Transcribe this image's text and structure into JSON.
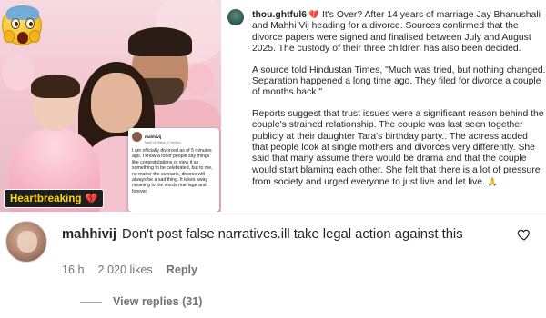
{
  "photo": {
    "tag_label": "Heartbreaking",
    "inset": {
      "username": "mahhivij",
      "subline": "Mahi Vij Mahhi Vj Verified",
      "text": "I am officially divorced as of 5 minutes ago. I know a lot of people say things like congratulations or view it as something to be celebrated, but to me, no matter the scenario, divorce will always be a sad thing. It takes away meaning to the words marriage and forever."
    }
  },
  "caption": {
    "username": "thou.ghtful6",
    "paragraphs": [
      "It's Over? After 14 years of marriage Jay Bhanushali and Mahhi Vij heading for a divorce. Sources confirmed that the divorce papers were signed and finalised between July and August 2025. The custody of their three children has also been decided.",
      "A source told Hindustan Times, \"Much was tried, but nothing changed. Separation happened a long time ago. They filed for divorce a couple of months back.\"",
      "Reports suggest that trust issues were a significant reason behind the couple's strained relationship. The couple was last seen together publicly at their daughter Tara's birthday party.. The actress added that people look at single mothers and divorces very differently. She said that many assume there would be drama and that the couple would start blaming each other. She felt that there is a lot of pressure from society and urged everyone to just live and let live."
    ]
  },
  "comment": {
    "username": "mahhivij",
    "text": "Don't post false narratives.ill take legal action against this",
    "time": "16 h",
    "likes": "2,020 likes",
    "reply_label": "Reply",
    "view_replies": "View replies (31)"
  },
  "colors": {
    "like_icon": "#262626",
    "banner_text": "#ffd400",
    "secondary_text": "#737373"
  }
}
